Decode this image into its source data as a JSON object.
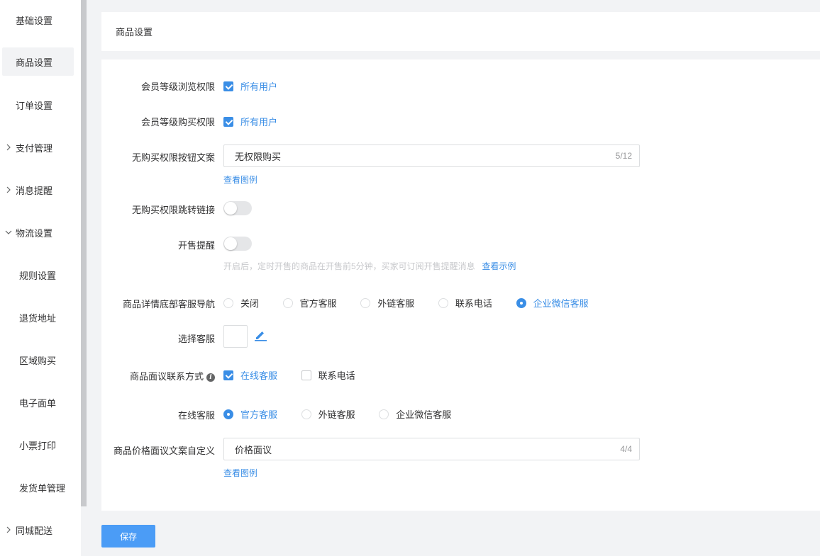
{
  "sidebar": {
    "items": [
      {
        "label": "基础设置"
      },
      {
        "label": "商品设置"
      },
      {
        "label": "订单设置"
      },
      {
        "label": "支付管理"
      },
      {
        "label": "消息提醒"
      },
      {
        "label": "物流设置"
      },
      {
        "label": "规则设置"
      },
      {
        "label": "退货地址"
      },
      {
        "label": "区域购买"
      },
      {
        "label": "电子面单"
      },
      {
        "label": "小票打印"
      },
      {
        "label": "发货单管理"
      },
      {
        "label": "同城配送"
      }
    ]
  },
  "header": {
    "title": "商品设置"
  },
  "form": {
    "browse_perm": {
      "label": "会员等级浏览权限",
      "option": "所有用户"
    },
    "buy_perm": {
      "label": "会员等级购买权限",
      "option": "所有用户"
    },
    "no_perm_button": {
      "label": "无购买权限按钮文案",
      "value": "无权限购买",
      "count": "5/12",
      "example_link": "查看图例"
    },
    "no_perm_link": {
      "label": "无购买权限跳转链接"
    },
    "sale_reminder": {
      "label": "开售提醒",
      "hint": "开启后，定时开售的商品在开售前5分钟，买家可订阅开售提醒消息",
      "example_link": "查看示例"
    },
    "service_nav": {
      "label": "商品详情底部客服导航",
      "options": [
        "关闭",
        "官方客服",
        "外链客服",
        "联系电话",
        "企业微信客服"
      ],
      "selected": "企业微信客服"
    },
    "choose_service": {
      "label": "选择客服"
    },
    "negotiate_contact": {
      "label": "商品面议联系方式",
      "options": [
        "在线客服",
        "联系电话"
      ]
    },
    "online_service": {
      "label": "在线客服",
      "options": [
        "官方客服",
        "外链客服",
        "企业微信客服"
      ],
      "selected": "官方客服"
    },
    "price_text": {
      "label": "商品价格面议文案自定义",
      "value": "价格面议",
      "count": "4/4",
      "example_link": "查看图例"
    }
  },
  "footer": {
    "save_label": "保存"
  },
  "colors": {
    "accent": "#3a8ee6",
    "button": "#4b9cf6"
  }
}
